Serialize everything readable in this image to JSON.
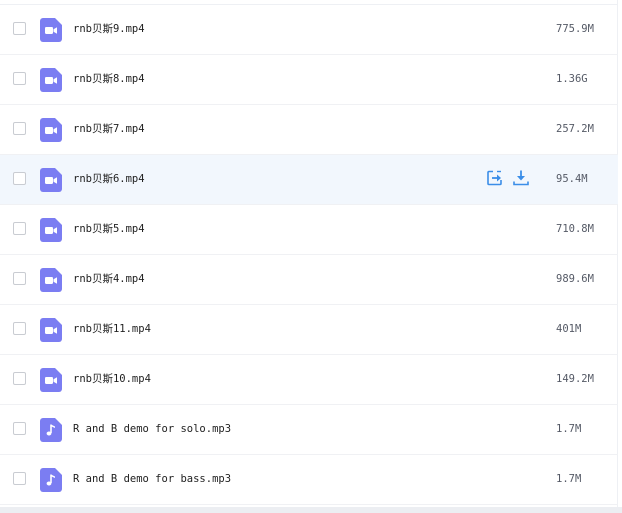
{
  "colors": {
    "video_icon": "#7b7df2",
    "audio_icon": "#7b7df2",
    "action_icon": "#3b8ee8",
    "hover_row": "#f2f7fd"
  },
  "files": [
    {
      "name": "rnb贝斯9.mp4",
      "size": "775.9M",
      "type": "video",
      "icon": "video-file-icon"
    },
    {
      "name": "rnb贝斯8.mp4",
      "size": "1.36G",
      "type": "video",
      "icon": "video-file-icon"
    },
    {
      "name": "rnb贝斯7.mp4",
      "size": "257.2M",
      "type": "video",
      "icon": "video-file-icon"
    },
    {
      "name": "rnb贝斯6.mp4",
      "size": "95.4M",
      "type": "video",
      "icon": "video-file-icon",
      "hovered": true
    },
    {
      "name": "rnb贝斯5.mp4",
      "size": "710.8M",
      "type": "video",
      "icon": "video-file-icon"
    },
    {
      "name": "rnb贝斯4.mp4",
      "size": "989.6M",
      "type": "video",
      "icon": "video-file-icon"
    },
    {
      "name": "rnb贝斯11.mp4",
      "size": "401M",
      "type": "video",
      "icon": "video-file-icon"
    },
    {
      "name": "rnb贝斯10.mp4",
      "size": "149.2M",
      "type": "video",
      "icon": "video-file-icon"
    },
    {
      "name": "R and B demo for solo.mp3",
      "size": "1.7M",
      "type": "audio",
      "icon": "audio-file-icon"
    },
    {
      "name": "R and B demo for bass.mp3",
      "size": "1.7M",
      "type": "audio",
      "icon": "audio-file-icon"
    }
  ],
  "row_actions": [
    "share-icon",
    "download-icon"
  ]
}
